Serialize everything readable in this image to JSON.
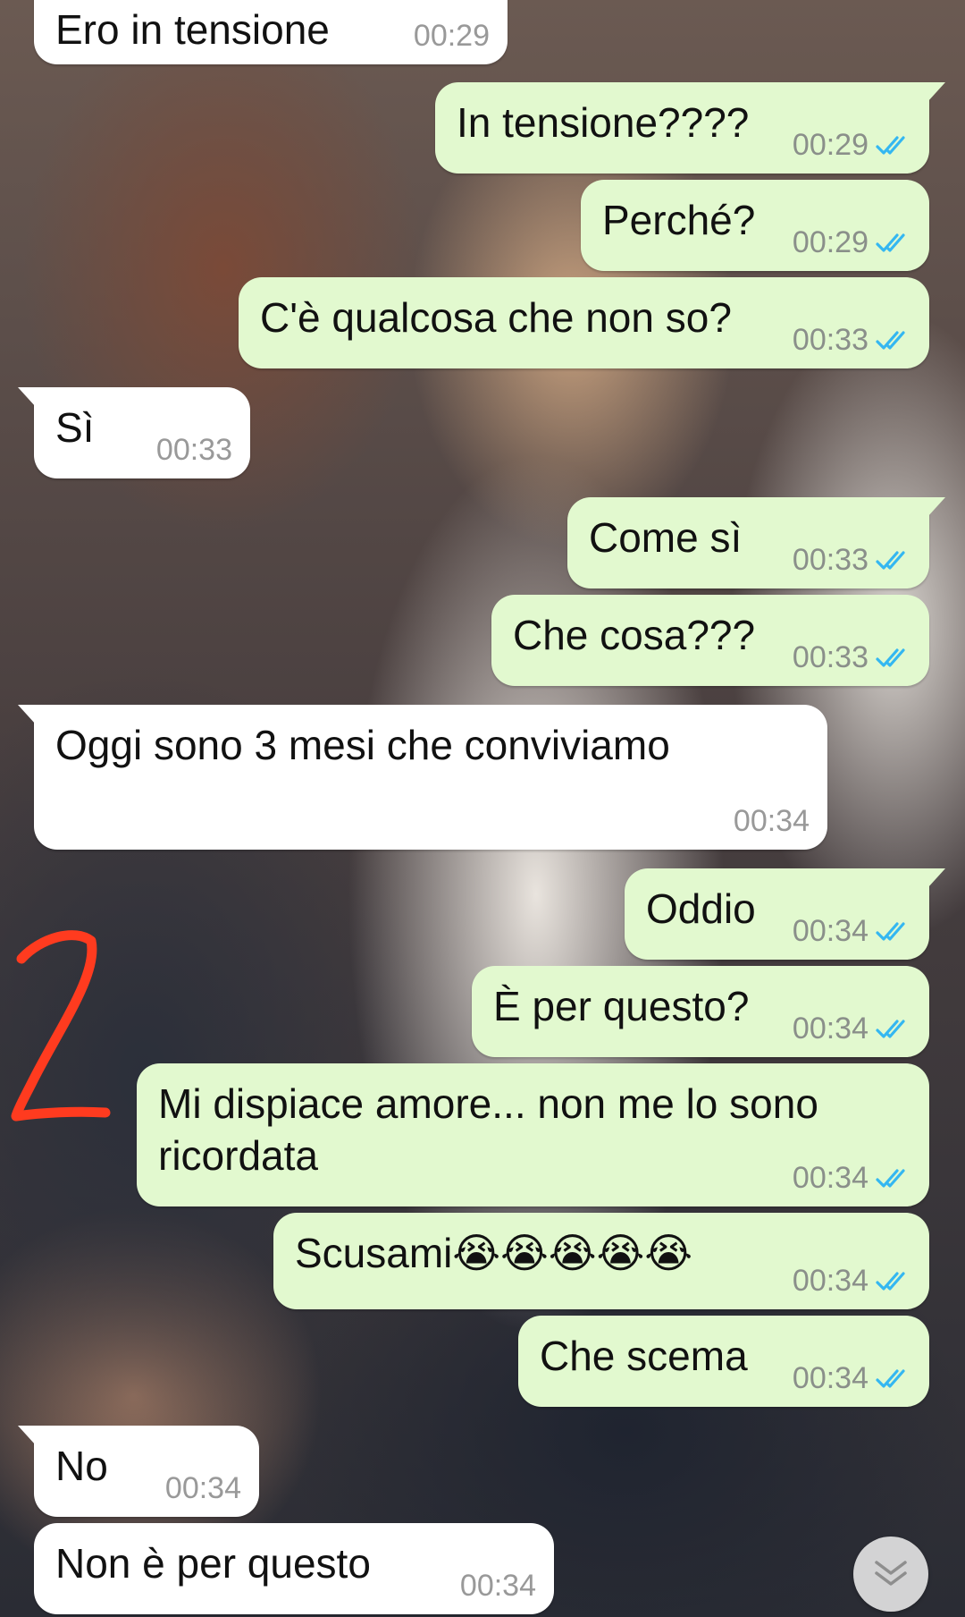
{
  "chat": {
    "messages": [
      {
        "text": "Ero in tensione",
        "time": "00:29",
        "direction": "incoming",
        "read": false
      },
      {
        "text": "In tensione????",
        "time": "00:29",
        "direction": "outgoing",
        "read": true
      },
      {
        "text": "Perché?",
        "time": "00:29",
        "direction": "outgoing",
        "read": true
      },
      {
        "text": "C'è qualcosa che non so?",
        "time": "00:33",
        "direction": "outgoing",
        "read": true
      },
      {
        "text": "Sì",
        "time": "00:33",
        "direction": "incoming",
        "read": false
      },
      {
        "text": "Come sì",
        "time": "00:33",
        "direction": "outgoing",
        "read": true
      },
      {
        "text": "Che cosa???",
        "time": "00:33",
        "direction": "outgoing",
        "read": true
      },
      {
        "text": "Oggi sono 3 mesi che conviviamo",
        "time": "00:34",
        "direction": "incoming",
        "read": false
      },
      {
        "text": "Oddio",
        "time": "00:34",
        "direction": "outgoing",
        "read": true
      },
      {
        "text": "È per questo?",
        "time": "00:34",
        "direction": "outgoing",
        "read": true
      },
      {
        "text": "Mi dispiace amore... non me lo sono ricordata",
        "time": "00:34",
        "direction": "outgoing",
        "read": true
      },
      {
        "text": "Scusami😭😭😭😭😭",
        "time": "00:34",
        "direction": "outgoing",
        "read": true
      },
      {
        "text": "Che scema",
        "time": "00:34",
        "direction": "outgoing",
        "read": true
      },
      {
        "text": "No",
        "time": "00:34",
        "direction": "incoming",
        "read": false
      },
      {
        "text": "Non è per questo",
        "time": "00:34",
        "direction": "incoming",
        "read": false
      }
    ]
  },
  "annotation": {
    "mark": "2",
    "color": "#ff3b1f"
  },
  "colors": {
    "incoming_bubble": "#ffffff",
    "outgoing_bubble": "#e2f9cf",
    "read_ticks": "#34b7f1",
    "timestamp": "#8a8f8a"
  },
  "icons": {
    "read_receipt": "double-check-icon",
    "scroll_down": "chevron-down-icon"
  }
}
